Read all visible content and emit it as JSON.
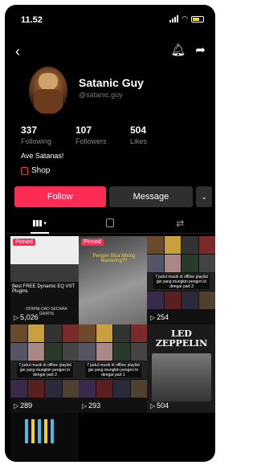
{
  "status_bar": {
    "time": "11.52"
  },
  "profile": {
    "display_name": "Satanic Guy",
    "username": "@satanic.guy",
    "stats": [
      {
        "value": "337",
        "label": "Following"
      },
      {
        "value": "107",
        "label": "Followers"
      },
      {
        "value": "504",
        "label": "Likes"
      }
    ],
    "bio": "Ave Satanas!",
    "shop_label": "Shop"
  },
  "actions": {
    "follow": "Follow",
    "message": "Message",
    "more": "⌄"
  },
  "icons": {
    "back": "chevron-left-icon",
    "notify": "bell-icon",
    "share": "share-icon",
    "grid": "grid-icon",
    "shop": "shopping-bag-icon",
    "repost": "repost-icon"
  },
  "videos": [
    {
      "pinned": "Pinned",
      "views": "5,026",
      "caption": "Best FREE Dynamic EQ VST Plugins",
      "caption2": "DOWNLOAD SECARA GRATIS"
    },
    {
      "pinned": "Pinned",
      "views": "",
      "caption": "Pengen Bisa Mixing Mastering??"
    },
    {
      "views": "254",
      "caption": "7 judul musik di offline playlist gw yang mungkin pengen lo dengar part 3"
    },
    {
      "views": "289",
      "caption": "7 judul musik di offline playlist gw yang mungkin pengen lo dengar part 2"
    },
    {
      "views": "293",
      "caption": "7 judul musik di offline playlist gw yang mungkin pengen lo dengar part 1"
    },
    {
      "views": "504",
      "caption": "LED ZEPPELIN"
    }
  ],
  "colors": {
    "accent": "#fe2c55",
    "background": "#000000",
    "caption_yellow": "#f1d12c"
  }
}
